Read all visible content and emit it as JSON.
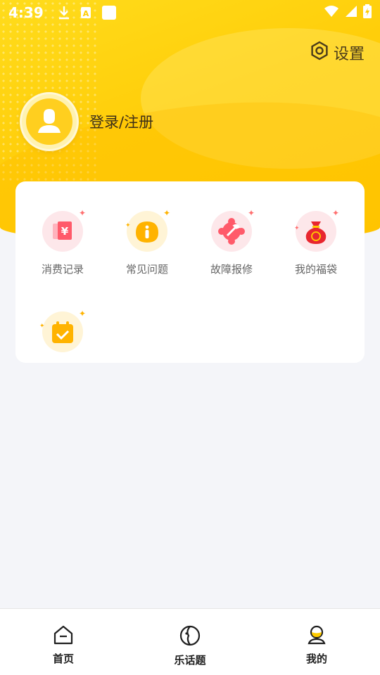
{
  "status_bar": {
    "time": "4:39",
    "icons": [
      "download-icon",
      "a-icon",
      "square-icon"
    ],
    "right_icons": [
      "wifi-icon",
      "signal-icon",
      "battery-icon"
    ]
  },
  "header": {
    "settings_label": "设置",
    "login_label": "登录/注册"
  },
  "menu": {
    "items": [
      {
        "label": "消费记录",
        "icon": "receipt-icon"
      },
      {
        "label": "常见问题",
        "icon": "info-icon"
      },
      {
        "label": "故障报修",
        "icon": "repair-icon"
      },
      {
        "label": "我的福袋",
        "icon": "lucky-bag-icon"
      },
      {
        "label": "",
        "icon": "calendar-check-icon"
      }
    ]
  },
  "bottom_nav": {
    "items": [
      {
        "label": "首页",
        "icon": "home-icon"
      },
      {
        "label": "乐话题",
        "icon": "topic-icon"
      },
      {
        "label": "我的",
        "icon": "profile-icon"
      }
    ]
  },
  "colors": {
    "brand_yellow": "#ffcc00",
    "card_bg": "#ffffff",
    "page_bg": "#f4f5f9"
  }
}
